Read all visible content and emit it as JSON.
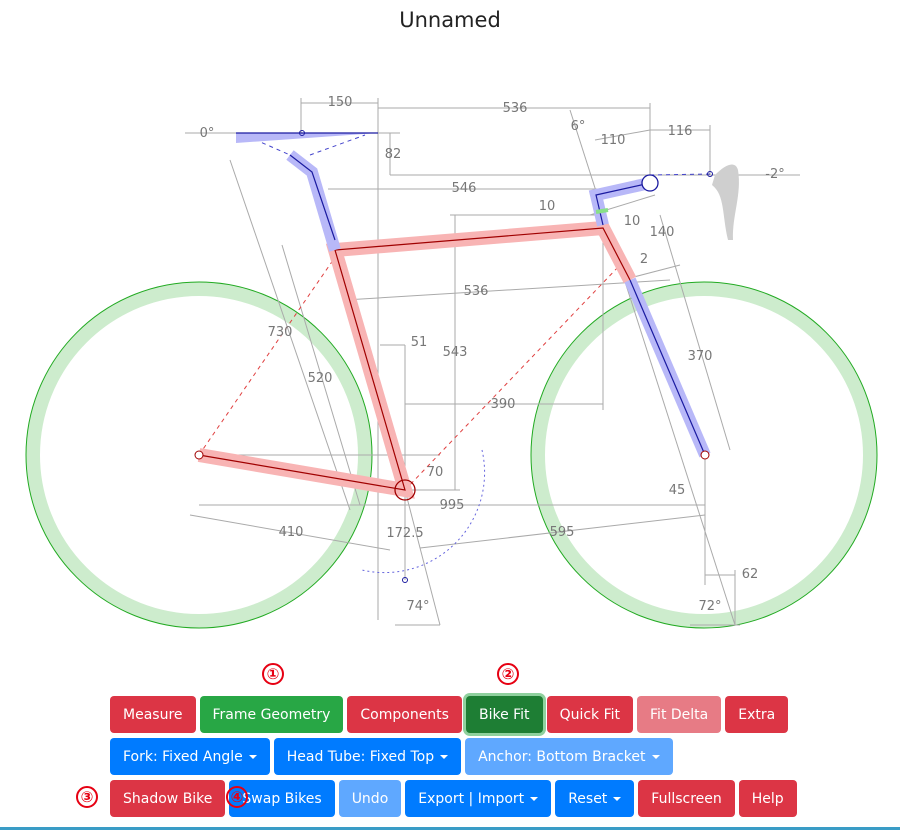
{
  "title": "Unnamed",
  "diagram": {
    "dimensions": {
      "saddle_setback": "150",
      "saddle_angle": "0°",
      "saddle_drop": "82",
      "reach_top": "536",
      "stem_angle": "6°",
      "stem_length": "110",
      "bar_reach": "116",
      "bar_angle": "-2°",
      "effective_top_tube": "546",
      "spacer_a": "10",
      "spacer_b": "10",
      "headset_stack": "140",
      "lower_headset": "2",
      "reach": "536",
      "saddle_height": "730",
      "seat_tube": "520",
      "seat_offset": "51",
      "stack": "543",
      "bb_to_ht": "390",
      "fork_length": "370",
      "bb_drop": "70",
      "wheelbase": "995",
      "fork_offset": "45",
      "chainstay": "410",
      "crank_length": "172.5",
      "front_center": "595",
      "trail": "62",
      "seat_angle": "74°",
      "head_angle": "72°"
    },
    "colors": {
      "frame": "#f4a9a9",
      "frame_line": "#a00000",
      "cockpit": "#b8b8f8",
      "cockpit_line": "#1a1aa0",
      "wheel_fill": "#cdeccd",
      "wheel_line": "#22aa22",
      "dimension": "#999999"
    }
  },
  "markers": [
    "①",
    "②",
    "③",
    "④"
  ],
  "toolbar": {
    "row1": [
      "Measure",
      "Frame Geometry",
      "Components",
      "Bike Fit",
      "Quick Fit",
      "Fit Delta",
      "Extra"
    ],
    "row2": [
      "Fork: Fixed Angle",
      "Head Tube: Fixed Top",
      "Anchor: Bottom Bracket"
    ],
    "row3": [
      "Shadow Bike",
      "Swap Bikes",
      "Undo",
      "Export | Import",
      "Reset",
      "Fullscreen",
      "Help"
    ]
  }
}
